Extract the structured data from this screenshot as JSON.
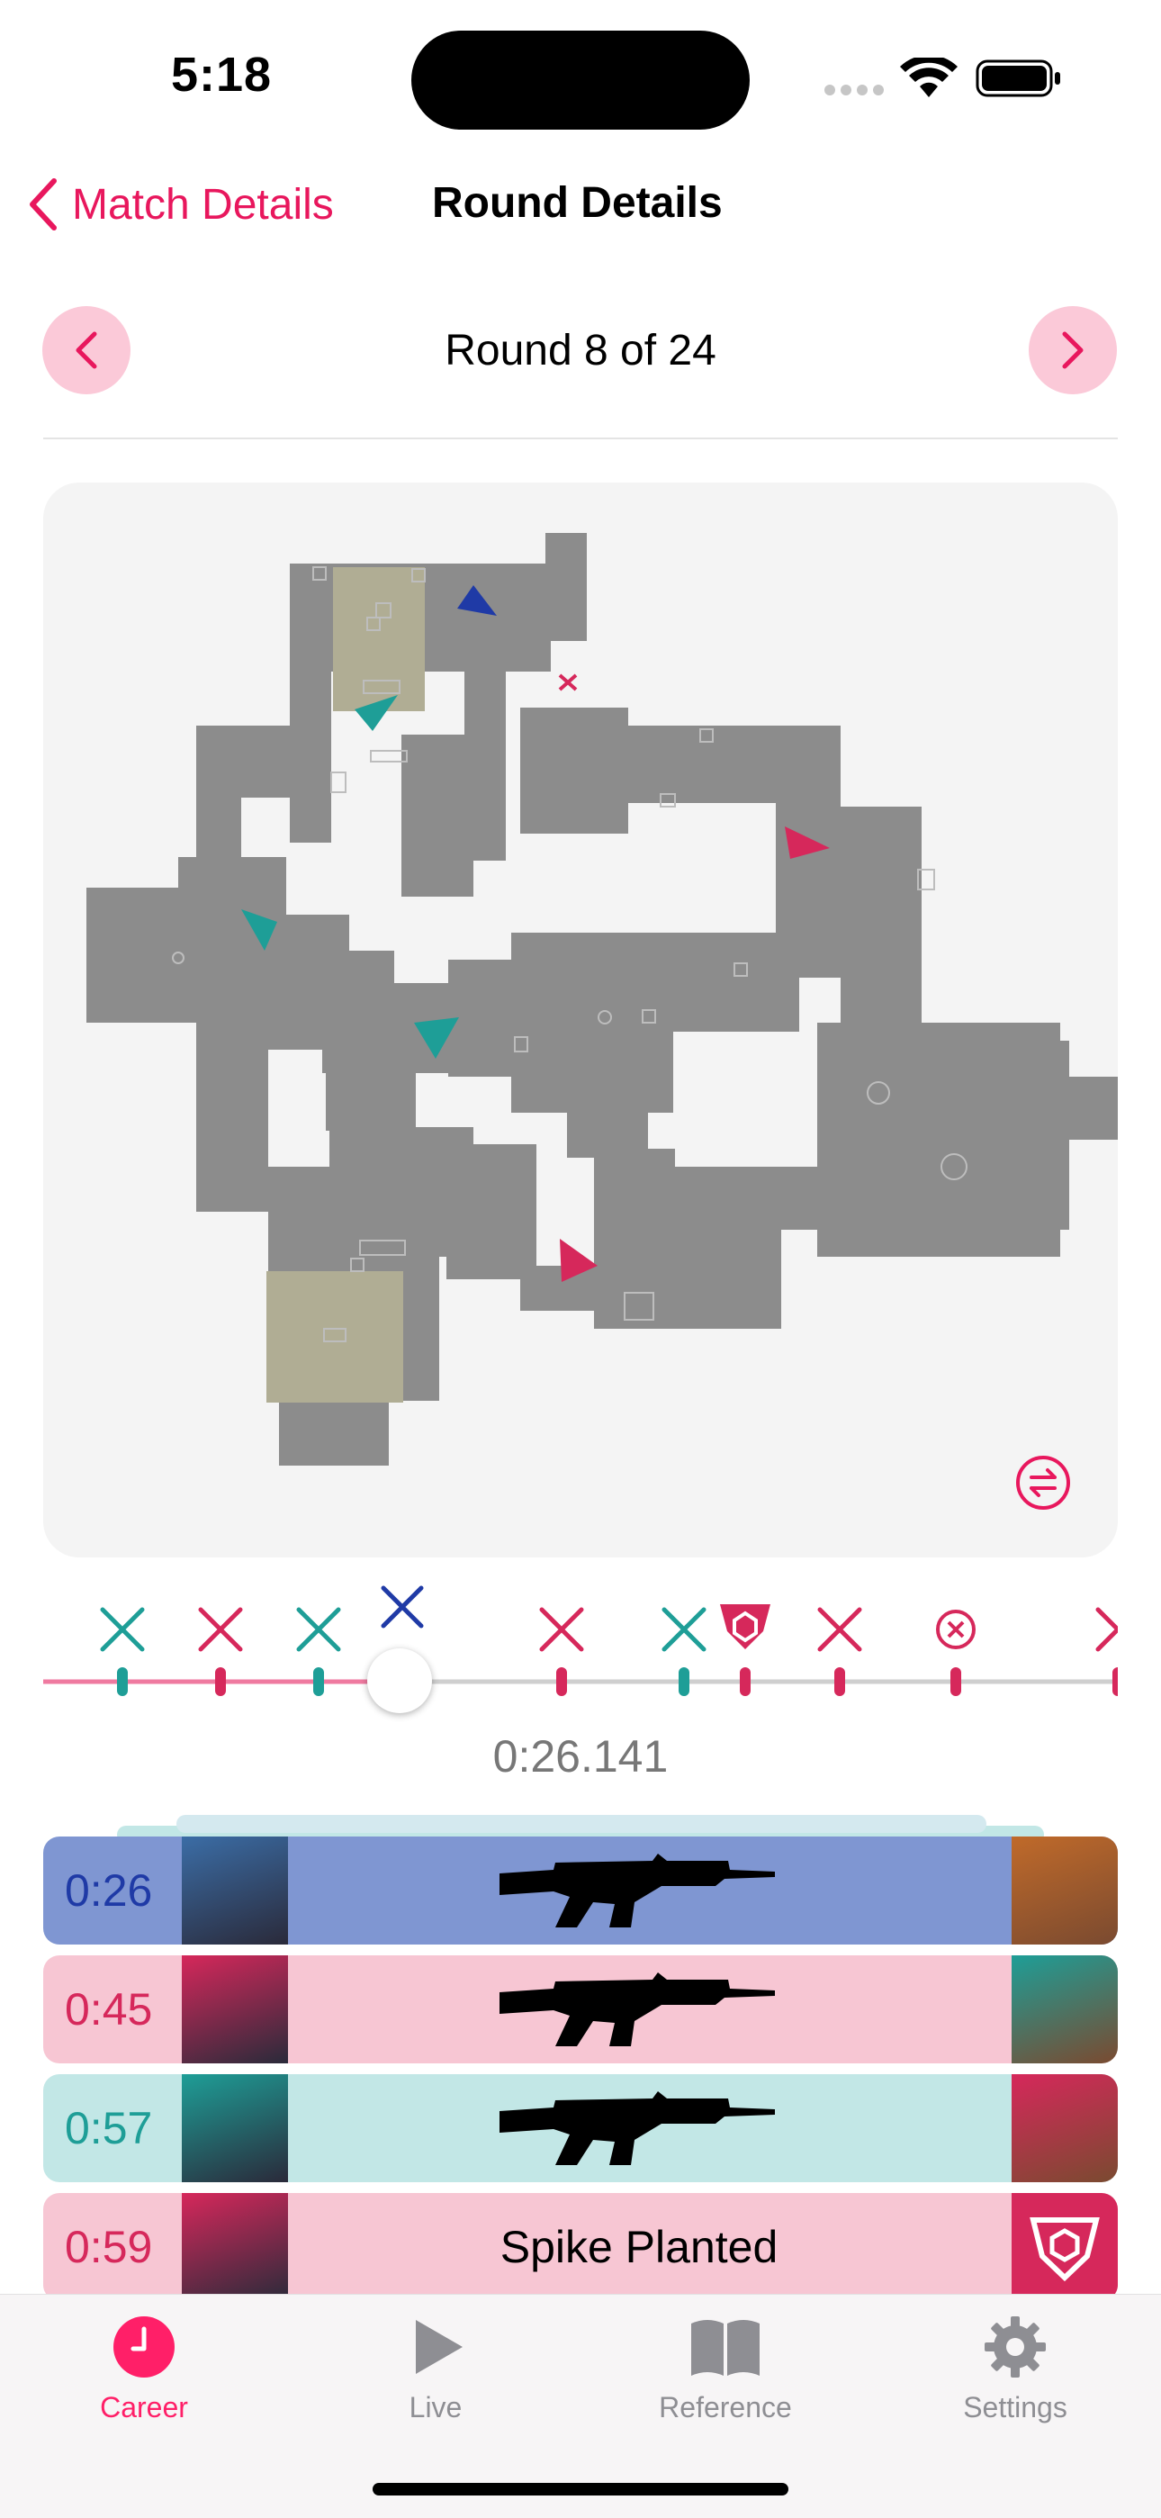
{
  "status_bar": {
    "time": "5:18"
  },
  "nav": {
    "back_label": "Match Details",
    "title": "Round Details"
  },
  "round": {
    "label": "Round 8 of 24"
  },
  "timeline": {
    "current_time": "0:26.141"
  },
  "events": [
    {
      "time": "0:26",
      "center_text": "",
      "weapon": "vandal-icon",
      "row_color": "#7f96d2",
      "time_color": "#1f3aa6"
    },
    {
      "time": "0:45",
      "center_text": "",
      "weapon": "vandal-icon",
      "row_color": "#f7c6d3",
      "time_color": "#d6285b"
    },
    {
      "time": "0:57",
      "center_text": "",
      "weapon": "vandal-icon",
      "row_color": "#c2e7e6",
      "time_color": "#1e9e97"
    },
    {
      "time": "0:59",
      "center_text": "Spike Planted",
      "weapon": "",
      "row_color": "#f7c6d3",
      "time_color": "#d6285b"
    }
  ],
  "tabs": [
    {
      "label": "Career",
      "icon": "clock-icon",
      "active": true
    },
    {
      "label": "Live",
      "icon": "play-icon",
      "active": false
    },
    {
      "label": "Reference",
      "icon": "book-icon",
      "active": false
    },
    {
      "label": "Settings",
      "icon": "gear-icon",
      "active": false
    }
  ],
  "colors": {
    "accent": "#e8175d",
    "defender": "#1e9e97",
    "attacker": "#d6285b",
    "self": "#1f3aa6",
    "map_floor": "#8c8c8c",
    "site": "#b0ad94"
  }
}
